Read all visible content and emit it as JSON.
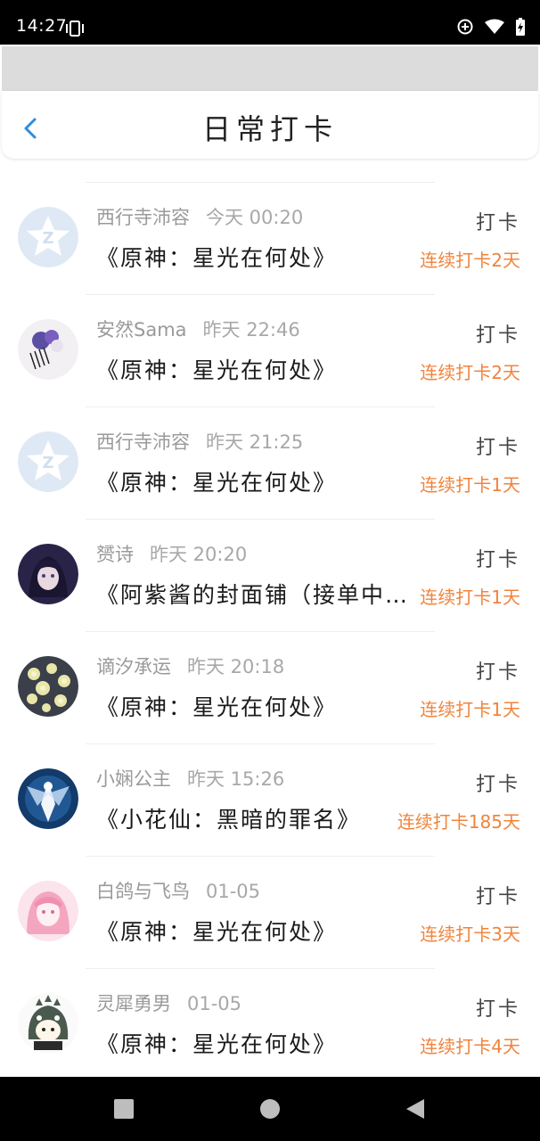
{
  "status": {
    "time": "14:27"
  },
  "header": {
    "title": "日常打卡"
  },
  "items": [
    {
      "name": "西行寺沛容",
      "time": "今天 00:20",
      "title": "《原神：星光在何处》",
      "action": "打卡",
      "streak": "连续打卡2天",
      "avatar": "app-logo-avatar"
    },
    {
      "name": "安然Sama",
      "time": "昨天 22:46",
      "title": "《原神：星光在何处》",
      "action": "打卡",
      "streak": "连续打卡2天",
      "avatar": "flower-hairpin-avatar"
    },
    {
      "name": "西行寺沛容",
      "time": "昨天 21:25",
      "title": "《原神：星光在何处》",
      "action": "打卡",
      "streak": "连续打卡1天",
      "avatar": "app-logo-avatar"
    },
    {
      "name": "赟诗",
      "time": "昨天 20:20",
      "title": "《阿紫酱的封面铺（接单中）》",
      "action": "打卡",
      "streak": "连续打卡1天",
      "avatar": "anime-girl-avatar"
    },
    {
      "name": "谪汐承运",
      "time": "昨天 20:18",
      "title": "《原神：星光在何处》",
      "action": "打卡",
      "streak": "连续打卡1天",
      "avatar": "floral-pattern-avatar"
    },
    {
      "name": "小娴公主",
      "time": "昨天 15:26",
      "title": "《小花仙：黑暗的罪名》",
      "action": "打卡",
      "streak": "连续打卡185天",
      "avatar": "fairy-avatar"
    },
    {
      "name": "白鸽与飞鸟",
      "time": "01-05",
      "title": "《原神：星光在何处》",
      "action": "打卡",
      "streak": "连续打卡3天",
      "avatar": "pink-hair-avatar"
    },
    {
      "name": "灵犀勇男",
      "time": "01-05",
      "title": "《原神：星光在何处》",
      "action": "打卡",
      "streak": "连续打卡4天",
      "avatar": "dino-hood-avatar"
    }
  ],
  "colors": {
    "accent": "#f0843c",
    "back": "#2f8ddc"
  }
}
